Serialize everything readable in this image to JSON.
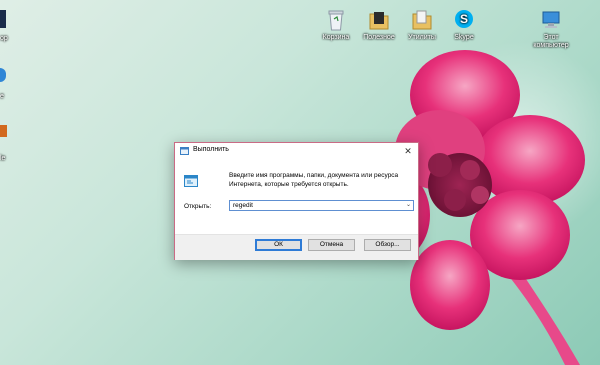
{
  "desktop": {
    "icons": [
      {
        "label": "Корзина",
        "icon": "recycle-bin-icon"
      },
      {
        "label": "Полезное",
        "icon": "folder-icon"
      },
      {
        "label": "Утилиты",
        "icon": "folder-icon"
      },
      {
        "label": "Skype",
        "icon": "skype-icon"
      },
      {
        "label": "Этот компьютер",
        "icon": "computer-icon"
      }
    ],
    "left_edge_labels": [
      "ор",
      "е",
      "le"
    ],
    "accent_color": "#e7317a"
  },
  "run_dialog": {
    "title": "Выполнить",
    "description": "Введите имя программы, папки, документа или ресурса Интернета, которые требуется открыть.",
    "open_label": "Открыть:",
    "open_value": "regedit",
    "buttons": {
      "ok": "ОК",
      "cancel": "Отмена",
      "browse": "Обзор..."
    },
    "close_glyph": "✕"
  }
}
